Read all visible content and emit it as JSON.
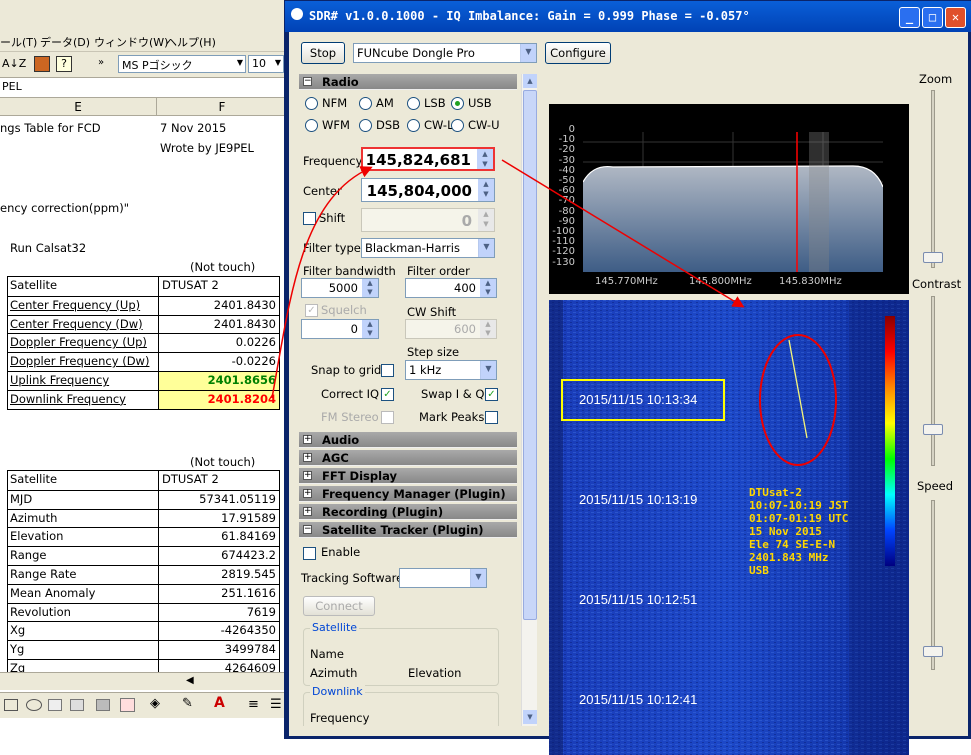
{
  "excel": {
    "menu": [
      "ール(T)",
      "データ(D)",
      "ウィンドウ(W)",
      "ヘルプ(H)"
    ],
    "font_name": "MS Pゴシック",
    "font_size": "10",
    "formula_value": "PEL",
    "col_e": "E",
    "col_f": "F",
    "text_rows": {
      "title": "ngs Table for FCD",
      "date": "7 Nov 2015",
      "author": "Wrote by JE9PEL",
      "correction": "ency correction(ppm)\"",
      "run": "Run Calsat32",
      "not_touch_1": "(Not touch)",
      "not_touch_2": "(Not touch)"
    },
    "table1": [
      {
        "label": "Satellite",
        "value": "DTUSAT 2",
        "underline": false
      },
      {
        "label": "Center Frequency (Up)",
        "value": "2401.8430",
        "underline": true
      },
      {
        "label": "Center Frequency (Dw)",
        "value": "2401.8430",
        "underline": true
      },
      {
        "label": "Doppler Frequency (Up)",
        "value": "0.0226",
        "underline": true
      },
      {
        "label": "Doppler Frequency (Dw)",
        "value": "-0.0226",
        "underline": true
      },
      {
        "label": "Uplink Frequency",
        "value": "2401.8656",
        "underline": true
      },
      {
        "label": "Downlink Frequency",
        "value": "2401.8204",
        "underline": true
      }
    ],
    "table2": [
      {
        "label": "Satellite",
        "value": "DTUSAT 2"
      },
      {
        "label": "MJD",
        "value": "57341.05119"
      },
      {
        "label": "Azimuth",
        "value": "17.91589"
      },
      {
        "label": "Elevation",
        "value": "61.84169"
      },
      {
        "label": "Range",
        "value": "674423.2"
      },
      {
        "label": "Range Rate",
        "value": "2819.545"
      },
      {
        "label": "Mean Anomaly",
        "value": "251.1616"
      },
      {
        "label": "Revolution",
        "value": "7619"
      },
      {
        "label": "Xg",
        "value": "-4264350"
      },
      {
        "label": "Yg",
        "value": "3499784"
      },
      {
        "label": "Zg",
        "value": "4264609"
      }
    ],
    "colors": {
      "uplink_bg": "#ffff99",
      "uplink_text": "#008000",
      "downlink_text": "#ff0000"
    }
  },
  "sdr": {
    "title": "SDR# v1.0.0.1000 - IQ Imbalance: Gain = 0.999 Phase = -0.057°",
    "stop_label": "Stop",
    "device": "FUNcube Dongle Pro",
    "configure_label": "Configure",
    "radio_section": "Radio",
    "modes": [
      {
        "label": "NFM",
        "on": false
      },
      {
        "label": "AM",
        "on": false
      },
      {
        "label": "LSB",
        "on": false
      },
      {
        "label": "USB",
        "on": true
      },
      {
        "label": "WFM",
        "on": false
      },
      {
        "label": "DSB",
        "on": false
      },
      {
        "label": "CW-L",
        "on": false
      },
      {
        "label": "CW-U",
        "on": false
      }
    ],
    "frequency_label": "Frequency",
    "frequency": "145,824,681",
    "center_label": "Center",
    "center": "145,804,000",
    "shift_label": "Shift",
    "shift": "0",
    "filter_type_label": "Filter type",
    "filter_type": "Blackman-Harris",
    "filter_bw_label": "Filter bandwidth",
    "filter_bw": "5000",
    "filter_order_label": "Filter order",
    "filter_order": "400",
    "squelch_label": "Squelch",
    "squelch": "0",
    "cw_shift_label": "CW Shift",
    "cw_shift": "600",
    "step_size_label": "Step size",
    "step_size": "1 kHz",
    "snap_label": "Snap to grid",
    "correct_iq_label": "Correct IQ",
    "swap_iq_label": "Swap I & Q",
    "fm_stereo_label": "FM Stereo",
    "mark_peaks_label": "Mark Peaks",
    "sections": [
      "Audio",
      "AGC",
      "FFT Display",
      "Frequency Manager (Plugin)",
      "Recording (Plugin)",
      "Satellite Tracker (Plugin)"
    ],
    "enable_label": "Enable",
    "tracking_label": "Tracking Software",
    "connect_label": "Connect",
    "satellite_group": "Satellite",
    "name_label": "Name",
    "azimuth_label": "Azimuth",
    "elevation_label": "Elevation",
    "downlink_group": "Downlink",
    "frequency2_label": "Frequency",
    "zoom_label": "Zoom",
    "contrast_label": "Contrast",
    "speed_label": "Speed",
    "spectrum_db_ticks": [
      "0",
      "-10",
      "-20",
      "-30",
      "-40",
      "-50",
      "-60",
      "-70",
      "-80",
      "-90",
      "-100",
      "-110",
      "-120",
      "-130"
    ],
    "spectrum_freq_ticks": [
      "145.770MHz",
      "145.800MHz",
      "145.830MHz"
    ],
    "timestamps": [
      "2015/11/15 10:13:34",
      "2015/11/15 10:13:19",
      "2015/11/15 10:12:51",
      "2015/11/15 10:12:41"
    ],
    "annotation": "DTUsat-2\n10:07-10:19 JST\n01:07-01:19 UTC\n15 Nov 2015\nEle 74 SE-E-N\n2401.843 MHz\nUSB",
    "annotation_color": "#ffd700",
    "marker_color": "#ff0000",
    "highlight_color": "#ffff00"
  }
}
